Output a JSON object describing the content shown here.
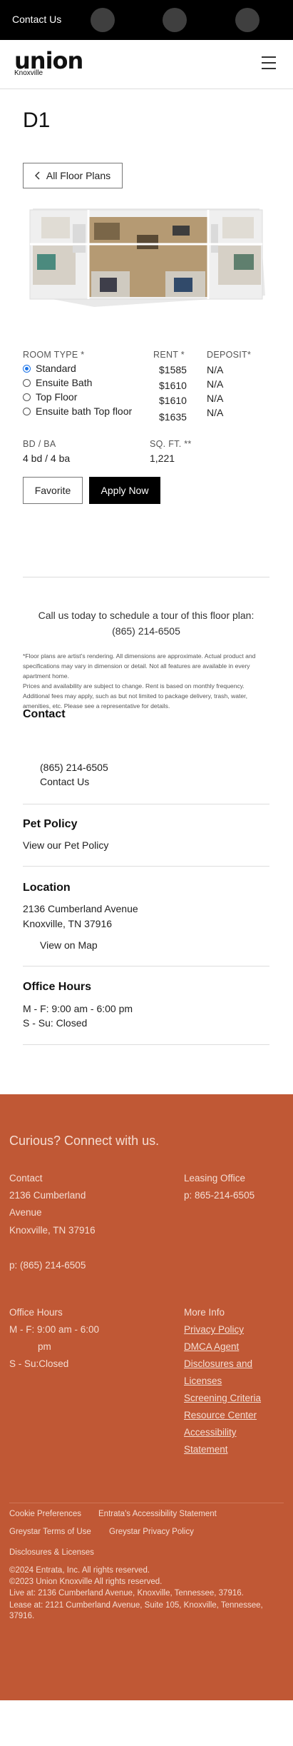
{
  "topbar": {
    "contact_label": "Contact Us"
  },
  "header": {
    "logo_word": "union",
    "logo_sub": "Knoxville"
  },
  "page": {
    "title": "D1",
    "back_label": "All Floor Plans"
  },
  "unit_table": {
    "headers": {
      "room_type": "ROOM TYPE *",
      "rent": "RENT *",
      "deposit": "DEPOSIT*"
    },
    "rows": [
      {
        "room_type": "Standard",
        "rent": "$1585",
        "deposit": "N/A",
        "selected": true
      },
      {
        "room_type": "Ensuite Bath",
        "rent": "$1610",
        "deposit": "N/A",
        "selected": false
      },
      {
        "room_type": "Top Floor",
        "rent": "$1610",
        "deposit": "N/A",
        "selected": false
      },
      {
        "room_type": "Ensuite bath Top floor",
        "rent": "$1635",
        "deposit": "N/A",
        "selected": false
      }
    ],
    "bd_ba_label": "BD / BA",
    "bd_ba_value": "4 bd / 4 ba",
    "sqft_label": "SQ. FT. **",
    "sqft_value": "1,221"
  },
  "actions": {
    "favorite": "Favorite",
    "apply": "Apply Now"
  },
  "call": {
    "text": "Call us today to schedule a tour of this floor plan:",
    "phone": "(865) 214-6505"
  },
  "disclaimer": {
    "p1": "*Floor plans are artist's rendering. All dimensions are approximate. Actual product and specifications may vary in dimension or detail. Not all features are available in every apartment home.",
    "p2": "Prices and availability are subject to change. Rent is based on monthly frequency. Additional fees may apply, such as but not limited to package delivery, trash, water, amenities, etc. Please see a representative for details."
  },
  "contact": {
    "heading": "Contact",
    "phone": "(865) 214-6505",
    "link": "Contact Us"
  },
  "pet": {
    "heading": "Pet Policy",
    "link": "View our Pet Policy"
  },
  "location": {
    "heading": "Location",
    "street": "2136 Cumberland Avenue",
    "city": "Knoxville, TN 37916",
    "map": "View on Map"
  },
  "hours": {
    "heading": "Office Hours",
    "weekday": "M - F:  9:00 am - 6:00 pm",
    "weekend": "S - Su:  Closed"
  },
  "footer": {
    "headline": "Curious? Connect with us.",
    "contact_h": "Contact",
    "addr1": "2136 Cumberland",
    "addr2": "Avenue",
    "addr3": "Knoxville, TN 37916",
    "phone": "p: (865) 214-6505",
    "leasing_h": "Leasing Office",
    "leasing_phone": "p: 865-214-6505",
    "hours_h": "Office Hours",
    "hours1": "M - F: 9:00 am - 6:00",
    "hours1b": "pm",
    "hours2": "S - Su:Closed",
    "more_h": "More Info",
    "links": [
      "Privacy Policy",
      "DMCA Agent",
      "Disclosures and",
      "Licenses",
      "Screening Criteria",
      "Resource Center",
      "Accessibility",
      "Statement"
    ],
    "bottom_links": [
      "Cookie Preferences",
      "Entrata's Accessibility Statement",
      "Greystar Terms of Use",
      "Greystar Privacy Policy",
      "Disclosures & Licenses"
    ],
    "copy1": "©2024 Entrata, Inc. All rights reserved.",
    "copy2": "©2023 Union Knoxville All rights reserved.",
    "copy3": "Live at: 2136 Cumberland Avenue, Knoxville, Tennessee, 37916.",
    "copy4": "Lease at: 2121 Cumberland Avenue, Suite 105, Knoxville, Tennessee, 37916."
  },
  "colors": {
    "footer_bg": "#c05835",
    "topbar_bg": "#000000"
  },
  "icons": {
    "menu": "hamburger-icon",
    "back": "chevron-left-icon"
  }
}
